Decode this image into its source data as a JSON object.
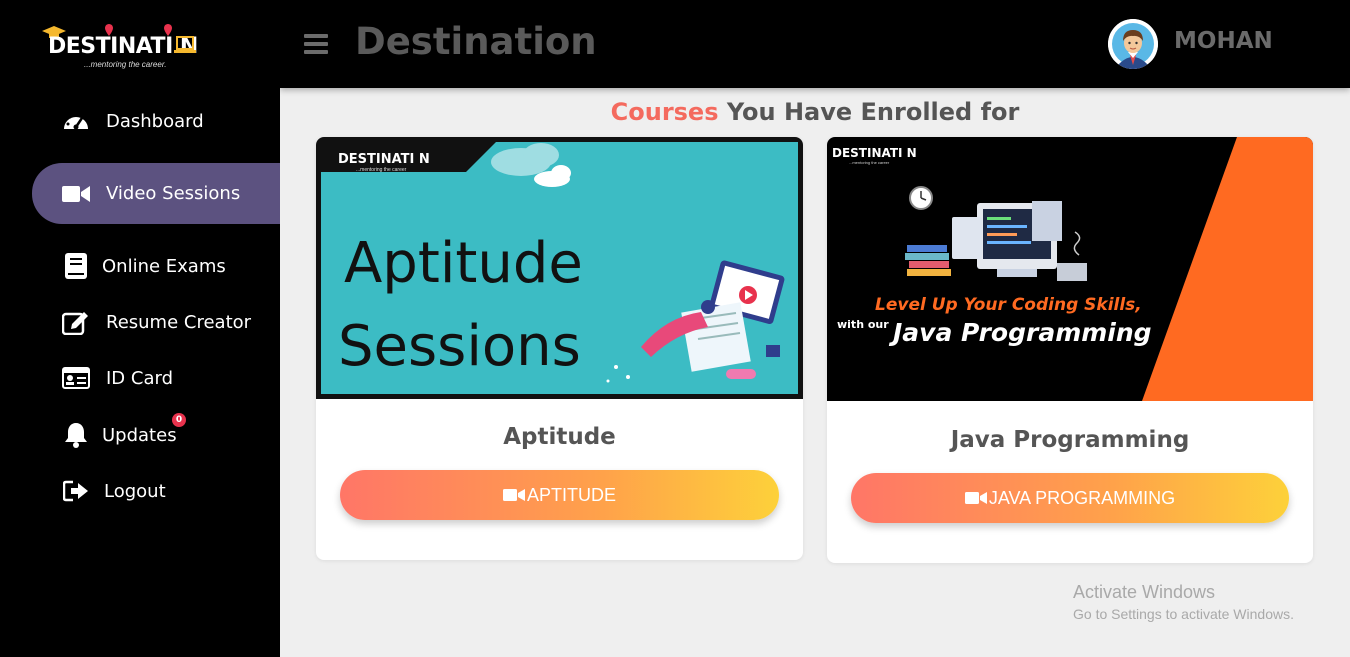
{
  "brand": {
    "logo_text": "DESTINATI N",
    "tagline": "...mentoring the career."
  },
  "header": {
    "title": "Destination",
    "username": "MOHAN"
  },
  "sidebar": {
    "items": [
      {
        "label": "Dashboard",
        "icon": "dashboard-gauge-icon"
      },
      {
        "label": "Video Sessions",
        "icon": "video-camera-icon",
        "active": true
      },
      {
        "label": "Online Exams",
        "icon": "book-icon"
      },
      {
        "label": "Resume Creator",
        "icon": "edit-icon"
      },
      {
        "label": "ID Card",
        "icon": "id-card-icon"
      },
      {
        "label": "Updates",
        "icon": "bell-icon",
        "badge": "0"
      },
      {
        "label": "Logout",
        "icon": "logout-icon"
      }
    ]
  },
  "main": {
    "heading_accent": "Courses",
    "heading_rest": " You Have Enrolled for",
    "courses": [
      {
        "name": "Aptitude",
        "button": "APTITUDE",
        "banner_title_1": "Aptitude",
        "banner_title_2": "Sessions",
        "banner_logo": "DESTINATI N",
        "banner_tagline": "...mentoring the career"
      },
      {
        "name": "Java Programming",
        "button": "JAVA PROGRAMMING",
        "banner_line_1": "Level Up Your Coding Skills,",
        "banner_line_2_prefix": "with our",
        "banner_line_2": "Java Programming",
        "banner_logo": "DESTINATI N",
        "banner_tagline": "...mentoring the career"
      }
    ]
  },
  "watermark": {
    "line1": "Activate Windows",
    "line2": "Go to Settings to activate Windows."
  },
  "colors": {
    "sidebar_bg": "#000000",
    "active_item": "#5c5280",
    "accent": "#f46a5e",
    "banner_teal": "#3cbcc4",
    "banner_orange": "#ff6a21"
  }
}
